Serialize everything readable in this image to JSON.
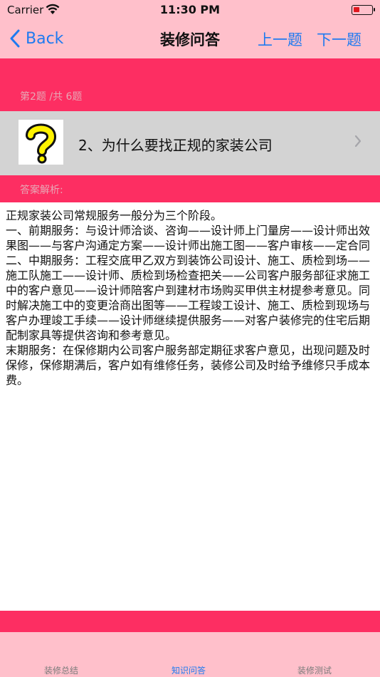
{
  "status_bar": {
    "carrier": "Carrier",
    "time": "11:30 PM"
  },
  "nav": {
    "back_label": "Back",
    "title": "装修问答",
    "prev_label": "上一题",
    "next_label": "下一题"
  },
  "question": {
    "counter": "第2题 /共 6题",
    "text": "2、为什么要找正规的家装公司",
    "icon": "question-mark-icon"
  },
  "answer": {
    "label": "答案解析:",
    "body": "正规家装公司常规服务一般分为三个阶段。\n一、前期服务：与设计师洽谈、咨询——设计师上门量房——设计师出效果图——与客户沟通定方案——设计师出施工图——客户审核——定合同\n二、中期服务：工程交底甲乙双方到装饰公司设计、施工、质检到场——施工队施工——设计师、质检到场检查把关——公司客户服务部征求施工中的客户意见——设计师陪客户到建材市场购买甲供主材提参考意见。同时解决施工中的变更洽商出图等——工程竣工设计、施工、质检到现场与客户办理竣工手续——设计师继续提供服务——对客户装修完的住宅后期配制家具等提供咨询和参考意见。\n末期服务：在保修期内公司客户服务部定期征求客户意见，出现问题及时保修，保修期满后，客户如有维修任务，装修公司及时给予维修只手成本费。"
  },
  "tabs": [
    {
      "label": "装修总结",
      "active": false
    },
    {
      "label": "知识问答",
      "active": true
    },
    {
      "label": "装修测试",
      "active": false
    }
  ],
  "colors": {
    "bar_pink": "#ffc0cb",
    "accent_red": "#fd2e62",
    "link_blue": "#1e7af0",
    "row_gray": "#d3d3d3",
    "icon_yellow": "#fff200"
  }
}
